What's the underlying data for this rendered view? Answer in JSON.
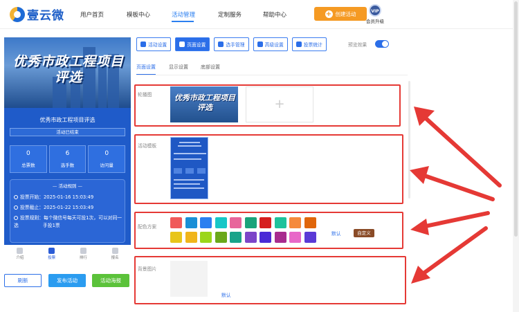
{
  "brand": {
    "name": "壹云微"
  },
  "nav": [
    {
      "label": "用户首页"
    },
    {
      "label": "模板中心"
    },
    {
      "label": "活动管理",
      "active": true
    },
    {
      "label": "定制服务"
    },
    {
      "label": "帮助中心"
    }
  ],
  "header": {
    "create_label": "创建活动",
    "vip_badge": "VIP",
    "vip_label": "会员升级"
  },
  "phone": {
    "banner_title": "优秀市政工程项目评选",
    "activity_title": "优秀市政工程项目评选",
    "status": "活动已结束",
    "stats": [
      {
        "num": "0",
        "label": "总票数"
      },
      {
        "num": "6",
        "label": "选手数"
      },
      {
        "num": "0",
        "label": "访问量"
      }
    ],
    "rules_heading": "— 活动规则 —",
    "rules": [
      "投票开始：2025-01-16 15:03:49",
      "投票截止：2025-01-22 15:03:49",
      "投票规则：每个微信号每天可投1次，可以对同一选",
      "手投1票"
    ],
    "tabs": [
      {
        "label": "介绍"
      },
      {
        "label": "投票",
        "active": true
      },
      {
        "label": "排行"
      },
      {
        "label": "报名"
      }
    ]
  },
  "bottom_buttons": {
    "refresh": "刷新",
    "publish": "发布活动",
    "poster": "活动海报"
  },
  "toolbar": [
    {
      "label": "活动设置"
    },
    {
      "label": "页面设置",
      "active": true
    },
    {
      "label": "选手管理"
    },
    {
      "label": "高级设置"
    },
    {
      "label": "投票统计"
    }
  ],
  "preview_label": "预览效果",
  "subtabs": [
    {
      "label": "页面设置",
      "active": true
    },
    {
      "label": "显示设置"
    },
    {
      "label": "底部设置"
    }
  ],
  "sections": {
    "carousel": {
      "label": "轮播图",
      "thumb_title": "优秀市政工程项目评选",
      "add": "+"
    },
    "template": {
      "label": "活动模板"
    },
    "color": {
      "label": "配色方案",
      "default": "默认",
      "custom": "自定义"
    },
    "background": {
      "label": "背景图片",
      "default": "默认"
    }
  },
  "colors": {
    "swatches_row1": [
      "#f05a5a",
      "#1a8fd6",
      "#2b7ff0",
      "#17c7c7",
      "#e8669b",
      "#1aa37a",
      "#d61e1e",
      "#1fc29b",
      "#f58a3c",
      "#e0660a"
    ],
    "swatches_row2": [
      "#e8c51a",
      "#f0b51a",
      "#9bd61a",
      "#6aa81a",
      "#1aa389",
      "#7c45c8",
      "#4a2bd6",
      "#a82b8e",
      "#e868c8",
      "#5a3ad6"
    ],
    "accent": "#2b6ee8",
    "annotation": "#e53935"
  }
}
